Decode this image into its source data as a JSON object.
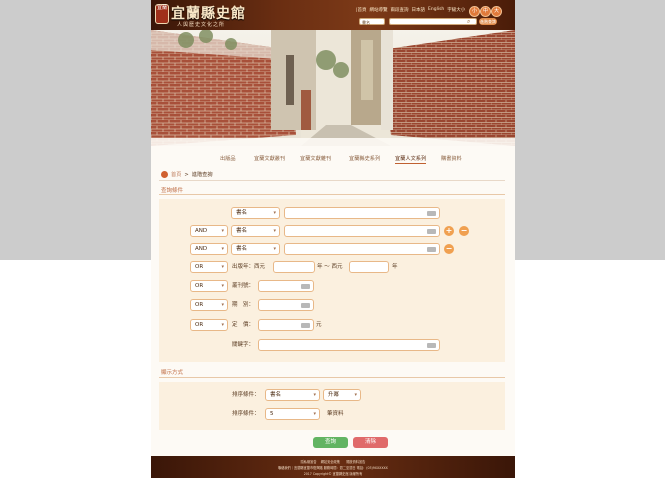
{
  "header": {
    "seal_text": "宜蘭",
    "site_title": "宜蘭縣史館",
    "site_subtitle": "人與歷史文化之所",
    "topnav": [
      "|首頁",
      "網站導覽",
      "兩段查詢",
      "日本語",
      "English",
      "字級大小"
    ],
    "font_size_buttons": [
      "小",
      "中",
      "大"
    ],
    "search_select": "書名",
    "search_placeholder": "",
    "advanced_label": "進階查詢"
  },
  "tabs": [
    {
      "label": "出版品",
      "active": false
    },
    {
      "label": "宜蘭文獻叢刊",
      "active": false
    },
    {
      "label": "宜蘭文獻雜刊",
      "active": false
    },
    {
      "label": "宜蘭縣史系列",
      "active": false
    },
    {
      "label": "宜蘭人文系列",
      "active": true
    },
    {
      "label": "購書資料",
      "active": false
    }
  ],
  "breadcrumb": {
    "home": "首頁",
    "sep": ">",
    "current": "進階查詢"
  },
  "search_section": {
    "title": "查詢條件",
    "rows": [
      {
        "op": "",
        "field": "書名"
      },
      {
        "op": "AND",
        "field": "書名"
      },
      {
        "op": "AND",
        "field": "書名"
      }
    ],
    "add_button": "+",
    "remove_button": "−",
    "year_op": "OR",
    "year_label": "出版年：西元",
    "year_to": "年 ～ 西元",
    "year_suffix": "年",
    "issn_op": "OR",
    "issn_label": "叢刊號：",
    "volume_op": "OR",
    "volume_label": "期　別：",
    "price_op": "OR",
    "price_label": "定　價：",
    "price_suffix": "元",
    "keyword_label": "關鍵字："
  },
  "sort_section": {
    "title": "顯示方式",
    "sort_label": "排序條件：",
    "sort_field": "書名",
    "sort_order": "升冪",
    "count_label": "排序條件：",
    "count_value": "5",
    "count_suffix": "筆資料"
  },
  "actions": {
    "search": "查詢",
    "clear": "清除"
  },
  "footer": {
    "line1": "隱私權宣告 　網站安全政策　　開放資料宣告",
    "line2": "聯絡我們｜宜蘭縣宜蘭市復興路 服務時間：週二至週日 電話：(03)9XXXXXX",
    "line3": "2017 Copyright© 宜蘭縣史館 版權所有"
  },
  "colors": {
    "header_bg": "#6a2e12",
    "accent": "#f0a050",
    "search_btn": "#62b462",
    "clear_btn": "#e06a6a"
  }
}
